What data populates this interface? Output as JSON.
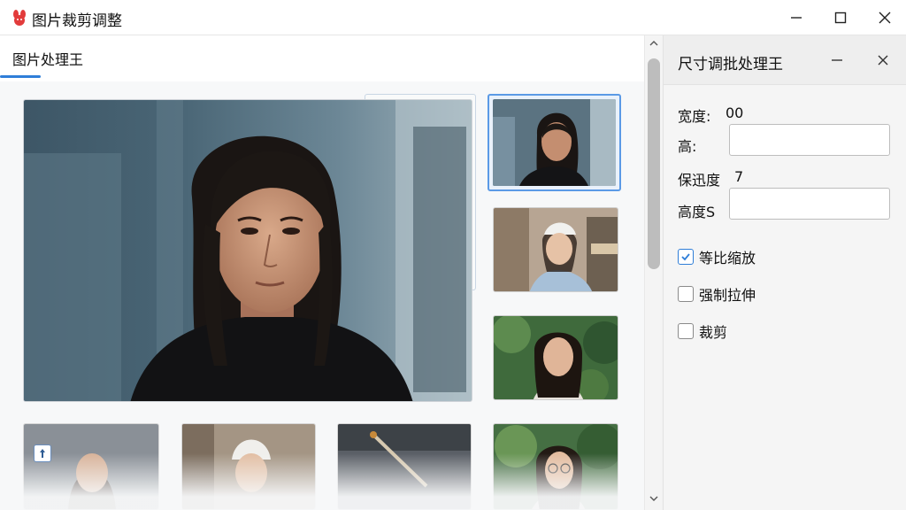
{
  "window": {
    "title": "图片裁剪调整",
    "icon": "bunny-logo-icon"
  },
  "left": {
    "tab_label": "图片处理王"
  },
  "panel": {
    "title": "尺寸调批处理王",
    "width_label": "宽度:",
    "width_value": "00",
    "height_label": "高:",
    "height_value": "",
    "quality_label": "保迅度",
    "quality_value": "7",
    "height2_label": "高度S",
    "height2_value": "",
    "options": [
      {
        "label": "等比缩放",
        "checked": true
      },
      {
        "label": "强制拉伸",
        "checked": false
      },
      {
        "label": "裁剪",
        "checked": false
      }
    ]
  },
  "colors": {
    "accent": "#2f7ed8",
    "selection_border": "#5b9ae6"
  }
}
